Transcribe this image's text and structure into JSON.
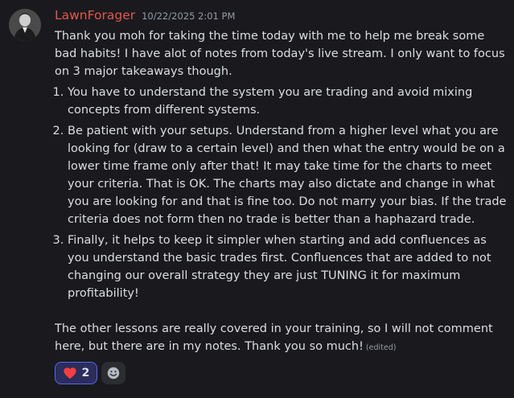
{
  "message": {
    "username": "LawnForager",
    "timestamp": "10/22/2025 2:01 PM",
    "intro": "Thank you moh for taking the time today with me to help me break some bad habits! I have alot of notes from today's live stream. I only want to focus on 3 major takeaways though.",
    "list_items": [
      "You have to understand the system you are trading and avoid mixing concepts from different systems.",
      "Be patient with your setups. Understand from a higher level what you are looking for (draw to a certain level) and then what the entry would be on a lower time frame only after that! It may take time for the charts to meet your criteria. That is OK. The charts may also dictate and change in what you are looking for and that is fine too. Do not marry your bias. If the trade criteria does not form then no trade is better than a haphazard trade.",
      "Finally, it helps to keep it simpler when starting and add confluences as you understand the basic trades first. Confluences that are added to not changing our overall strategy they are just TUNING it for maximum profitability!"
    ],
    "closing": "The other lessons are really covered in your training, so I will not comment here, but there are in my notes. Thank you so much!",
    "edited_label": "(edited)"
  },
  "reactions": [
    {
      "emoji": "heart-icon",
      "count": "2",
      "selected": true
    },
    {
      "emoji": "add-reaction-icon"
    }
  ],
  "colors": {
    "background": "#1a1a1e",
    "username": "#e2584c",
    "text": "#dbdee1",
    "muted": "#949ba4",
    "reaction_selected_border": "#5865f2",
    "heart": "#f23f43"
  }
}
